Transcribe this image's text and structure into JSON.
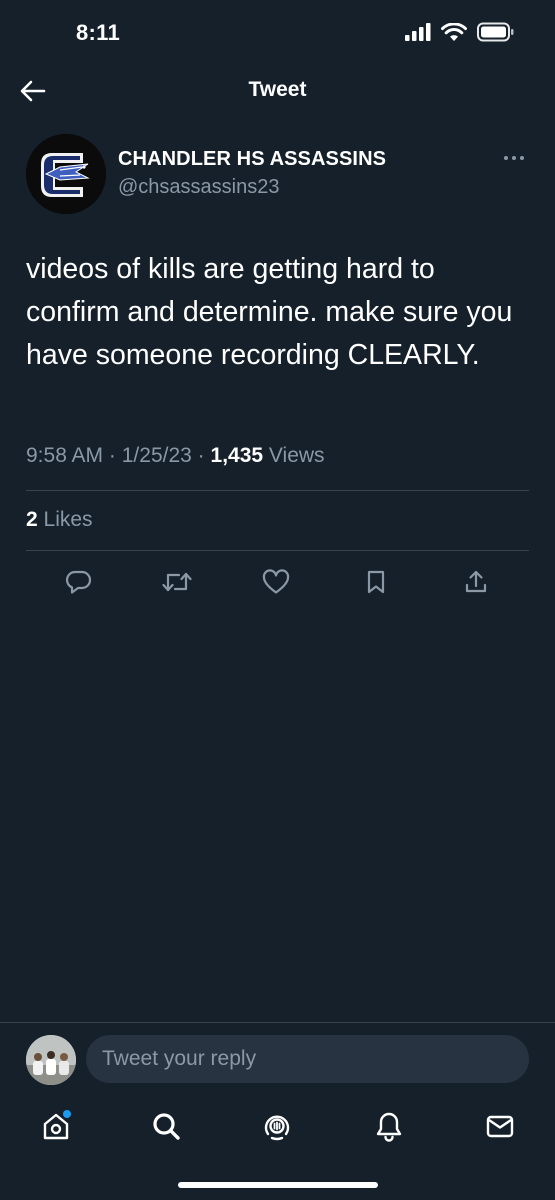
{
  "status_bar": {
    "time": "8:11"
  },
  "header": {
    "title": "Tweet"
  },
  "tweet": {
    "author_name": "CHANDLER HS ASSASSINS",
    "author_handle": "@chsassassins23",
    "text": "videos of kills are getting hard to confirm and determine. make sure you have someone recording CLEARLY.",
    "time": "9:58 AM",
    "date": "1/25/23",
    "views_count": "1,435",
    "views_label": "Views",
    "likes_count": "2",
    "likes_label": "Likes",
    "separator": "·"
  },
  "actions": [
    "reply-icon",
    "retweet-icon",
    "like-icon",
    "bookmark-icon",
    "share-icon"
  ],
  "reply": {
    "placeholder": "Tweet your reply"
  },
  "tab_bar": [
    "home-icon",
    "search-icon",
    "spaces-icon",
    "notifications-icon",
    "messages-icon"
  ],
  "colors": {
    "background": "#15202b",
    "secondary_text": "#8b98a5",
    "divider": "#38444d",
    "accent": "#1d9bf0",
    "icon": "#ffffff"
  }
}
